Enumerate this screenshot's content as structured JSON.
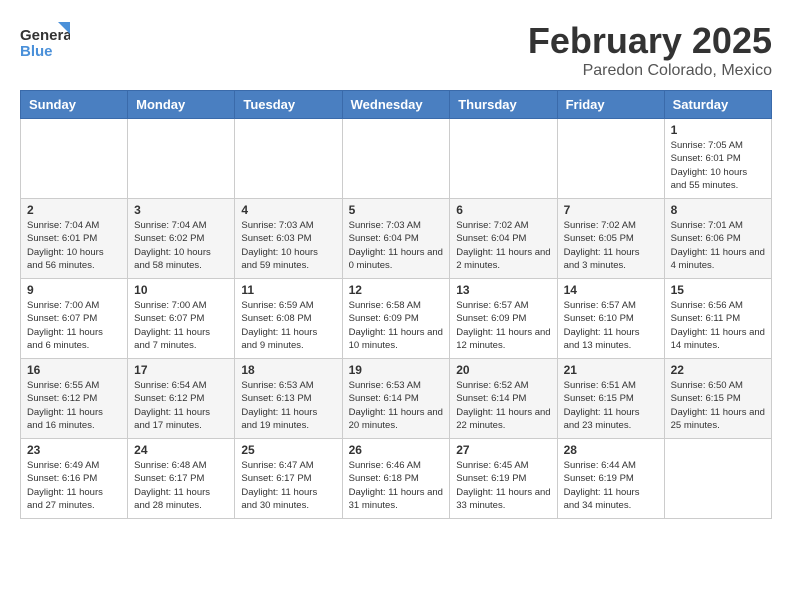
{
  "logo": {
    "line1": "General",
    "line2": "Blue"
  },
  "title": "February 2025",
  "location": "Paredon Colorado, Mexico",
  "days_header": [
    "Sunday",
    "Monday",
    "Tuesday",
    "Wednesday",
    "Thursday",
    "Friday",
    "Saturday"
  ],
  "weeks": [
    [
      {
        "day": "",
        "info": ""
      },
      {
        "day": "",
        "info": ""
      },
      {
        "day": "",
        "info": ""
      },
      {
        "day": "",
        "info": ""
      },
      {
        "day": "",
        "info": ""
      },
      {
        "day": "",
        "info": ""
      },
      {
        "day": "1",
        "info": "Sunrise: 7:05 AM\nSunset: 6:01 PM\nDaylight: 10 hours and 55 minutes."
      }
    ],
    [
      {
        "day": "2",
        "info": "Sunrise: 7:04 AM\nSunset: 6:01 PM\nDaylight: 10 hours and 56 minutes."
      },
      {
        "day": "3",
        "info": "Sunrise: 7:04 AM\nSunset: 6:02 PM\nDaylight: 10 hours and 58 minutes."
      },
      {
        "day": "4",
        "info": "Sunrise: 7:03 AM\nSunset: 6:03 PM\nDaylight: 10 hours and 59 minutes."
      },
      {
        "day": "5",
        "info": "Sunrise: 7:03 AM\nSunset: 6:04 PM\nDaylight: 11 hours and 0 minutes."
      },
      {
        "day": "6",
        "info": "Sunrise: 7:02 AM\nSunset: 6:04 PM\nDaylight: 11 hours and 2 minutes."
      },
      {
        "day": "7",
        "info": "Sunrise: 7:02 AM\nSunset: 6:05 PM\nDaylight: 11 hours and 3 minutes."
      },
      {
        "day": "8",
        "info": "Sunrise: 7:01 AM\nSunset: 6:06 PM\nDaylight: 11 hours and 4 minutes."
      }
    ],
    [
      {
        "day": "9",
        "info": "Sunrise: 7:00 AM\nSunset: 6:07 PM\nDaylight: 11 hours and 6 minutes."
      },
      {
        "day": "10",
        "info": "Sunrise: 7:00 AM\nSunset: 6:07 PM\nDaylight: 11 hours and 7 minutes."
      },
      {
        "day": "11",
        "info": "Sunrise: 6:59 AM\nSunset: 6:08 PM\nDaylight: 11 hours and 9 minutes."
      },
      {
        "day": "12",
        "info": "Sunrise: 6:58 AM\nSunset: 6:09 PM\nDaylight: 11 hours and 10 minutes."
      },
      {
        "day": "13",
        "info": "Sunrise: 6:57 AM\nSunset: 6:09 PM\nDaylight: 11 hours and 12 minutes."
      },
      {
        "day": "14",
        "info": "Sunrise: 6:57 AM\nSunset: 6:10 PM\nDaylight: 11 hours and 13 minutes."
      },
      {
        "day": "15",
        "info": "Sunrise: 6:56 AM\nSunset: 6:11 PM\nDaylight: 11 hours and 14 minutes."
      }
    ],
    [
      {
        "day": "16",
        "info": "Sunrise: 6:55 AM\nSunset: 6:12 PM\nDaylight: 11 hours and 16 minutes."
      },
      {
        "day": "17",
        "info": "Sunrise: 6:54 AM\nSunset: 6:12 PM\nDaylight: 11 hours and 17 minutes."
      },
      {
        "day": "18",
        "info": "Sunrise: 6:53 AM\nSunset: 6:13 PM\nDaylight: 11 hours and 19 minutes."
      },
      {
        "day": "19",
        "info": "Sunrise: 6:53 AM\nSunset: 6:14 PM\nDaylight: 11 hours and 20 minutes."
      },
      {
        "day": "20",
        "info": "Sunrise: 6:52 AM\nSunset: 6:14 PM\nDaylight: 11 hours and 22 minutes."
      },
      {
        "day": "21",
        "info": "Sunrise: 6:51 AM\nSunset: 6:15 PM\nDaylight: 11 hours and 23 minutes."
      },
      {
        "day": "22",
        "info": "Sunrise: 6:50 AM\nSunset: 6:15 PM\nDaylight: 11 hours and 25 minutes."
      }
    ],
    [
      {
        "day": "23",
        "info": "Sunrise: 6:49 AM\nSunset: 6:16 PM\nDaylight: 11 hours and 27 minutes."
      },
      {
        "day": "24",
        "info": "Sunrise: 6:48 AM\nSunset: 6:17 PM\nDaylight: 11 hours and 28 minutes."
      },
      {
        "day": "25",
        "info": "Sunrise: 6:47 AM\nSunset: 6:17 PM\nDaylight: 11 hours and 30 minutes."
      },
      {
        "day": "26",
        "info": "Sunrise: 6:46 AM\nSunset: 6:18 PM\nDaylight: 11 hours and 31 minutes."
      },
      {
        "day": "27",
        "info": "Sunrise: 6:45 AM\nSunset: 6:19 PM\nDaylight: 11 hours and 33 minutes."
      },
      {
        "day": "28",
        "info": "Sunrise: 6:44 AM\nSunset: 6:19 PM\nDaylight: 11 hours and 34 minutes."
      },
      {
        "day": "",
        "info": ""
      }
    ]
  ]
}
